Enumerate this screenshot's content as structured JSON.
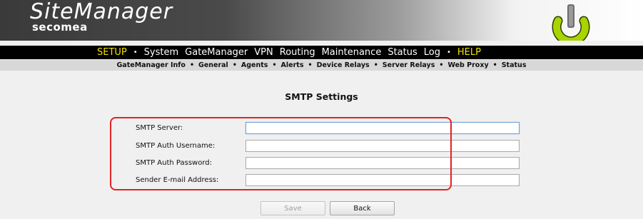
{
  "brand": {
    "product": "SiteManager",
    "company": "secomea"
  },
  "menu": {
    "items": [
      {
        "label": "SETUP",
        "active": true
      },
      {
        "label": "System"
      },
      {
        "label": "GateManager"
      },
      {
        "label": "VPN"
      },
      {
        "label": "Routing"
      },
      {
        "label": "Maintenance"
      },
      {
        "label": "Status"
      },
      {
        "label": "Log"
      },
      {
        "label": "HELP",
        "help": true
      }
    ],
    "separator": "•"
  },
  "submenu": {
    "items": [
      "GateManager Info",
      "General",
      "Agents",
      "Alerts",
      "Device Relays",
      "Server Relays",
      "Web Proxy",
      "Status"
    ],
    "separator": "•"
  },
  "page": {
    "title": "SMTP Settings"
  },
  "form": {
    "fields": [
      {
        "label": "SMTP Server:",
        "value": ""
      },
      {
        "label": "SMTP Auth Username:",
        "value": ""
      },
      {
        "label": "SMTP Auth Password:",
        "value": ""
      },
      {
        "label": "Sender E-mail Address:",
        "value": ""
      }
    ]
  },
  "buttons": {
    "save": "Save",
    "back": "Back"
  },
  "colors": {
    "menu_bg": "#000000",
    "menu_active": "#f0e000",
    "highlight_border": "#e32222",
    "power_icon": "#a8d400"
  },
  "icons": {
    "power": "power-icon"
  }
}
